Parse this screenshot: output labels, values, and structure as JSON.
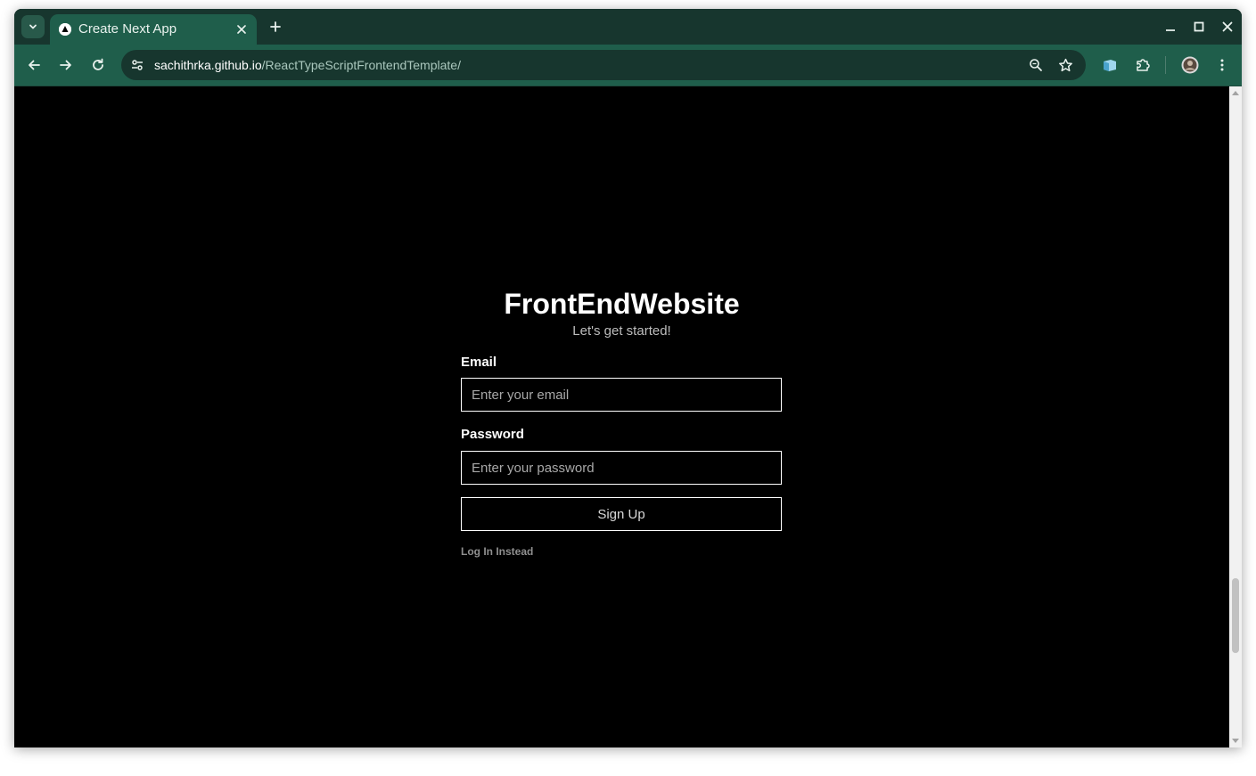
{
  "browser": {
    "tab_title": "Create Next App",
    "url_host": "sachithrka.github.io",
    "url_path": "/ReactTypeScriptFrontendTemplate/"
  },
  "page": {
    "title": "FrontEndWebsite",
    "subtitle": "Let's get started!",
    "email_label": "Email",
    "email_placeholder": "Enter your email",
    "email_value": "",
    "password_label": "Password",
    "password_placeholder": "Enter your password",
    "password_value": "",
    "signup_label": "Sign Up",
    "login_link": "Log In Instead"
  },
  "icons": {
    "tab_search": "chevron-down-icon",
    "favicon": "nextjs-triangle-icon",
    "tab_close": "close-icon",
    "new_tab": "plus-icon",
    "back": "arrow-left-icon",
    "forward": "arrow-right-icon",
    "reload": "reload-icon",
    "site_info": "tune-icon",
    "zoom": "magnifier-icon",
    "bookmark": "star-icon",
    "extension_app": "app-icon",
    "extensions": "puzzle-icon",
    "profile": "avatar-icon",
    "menu": "kebab-icon"
  },
  "colors": {
    "tabstrip": "#17362e",
    "toolbar": "#1f5e4b",
    "page_background": "#000000"
  }
}
